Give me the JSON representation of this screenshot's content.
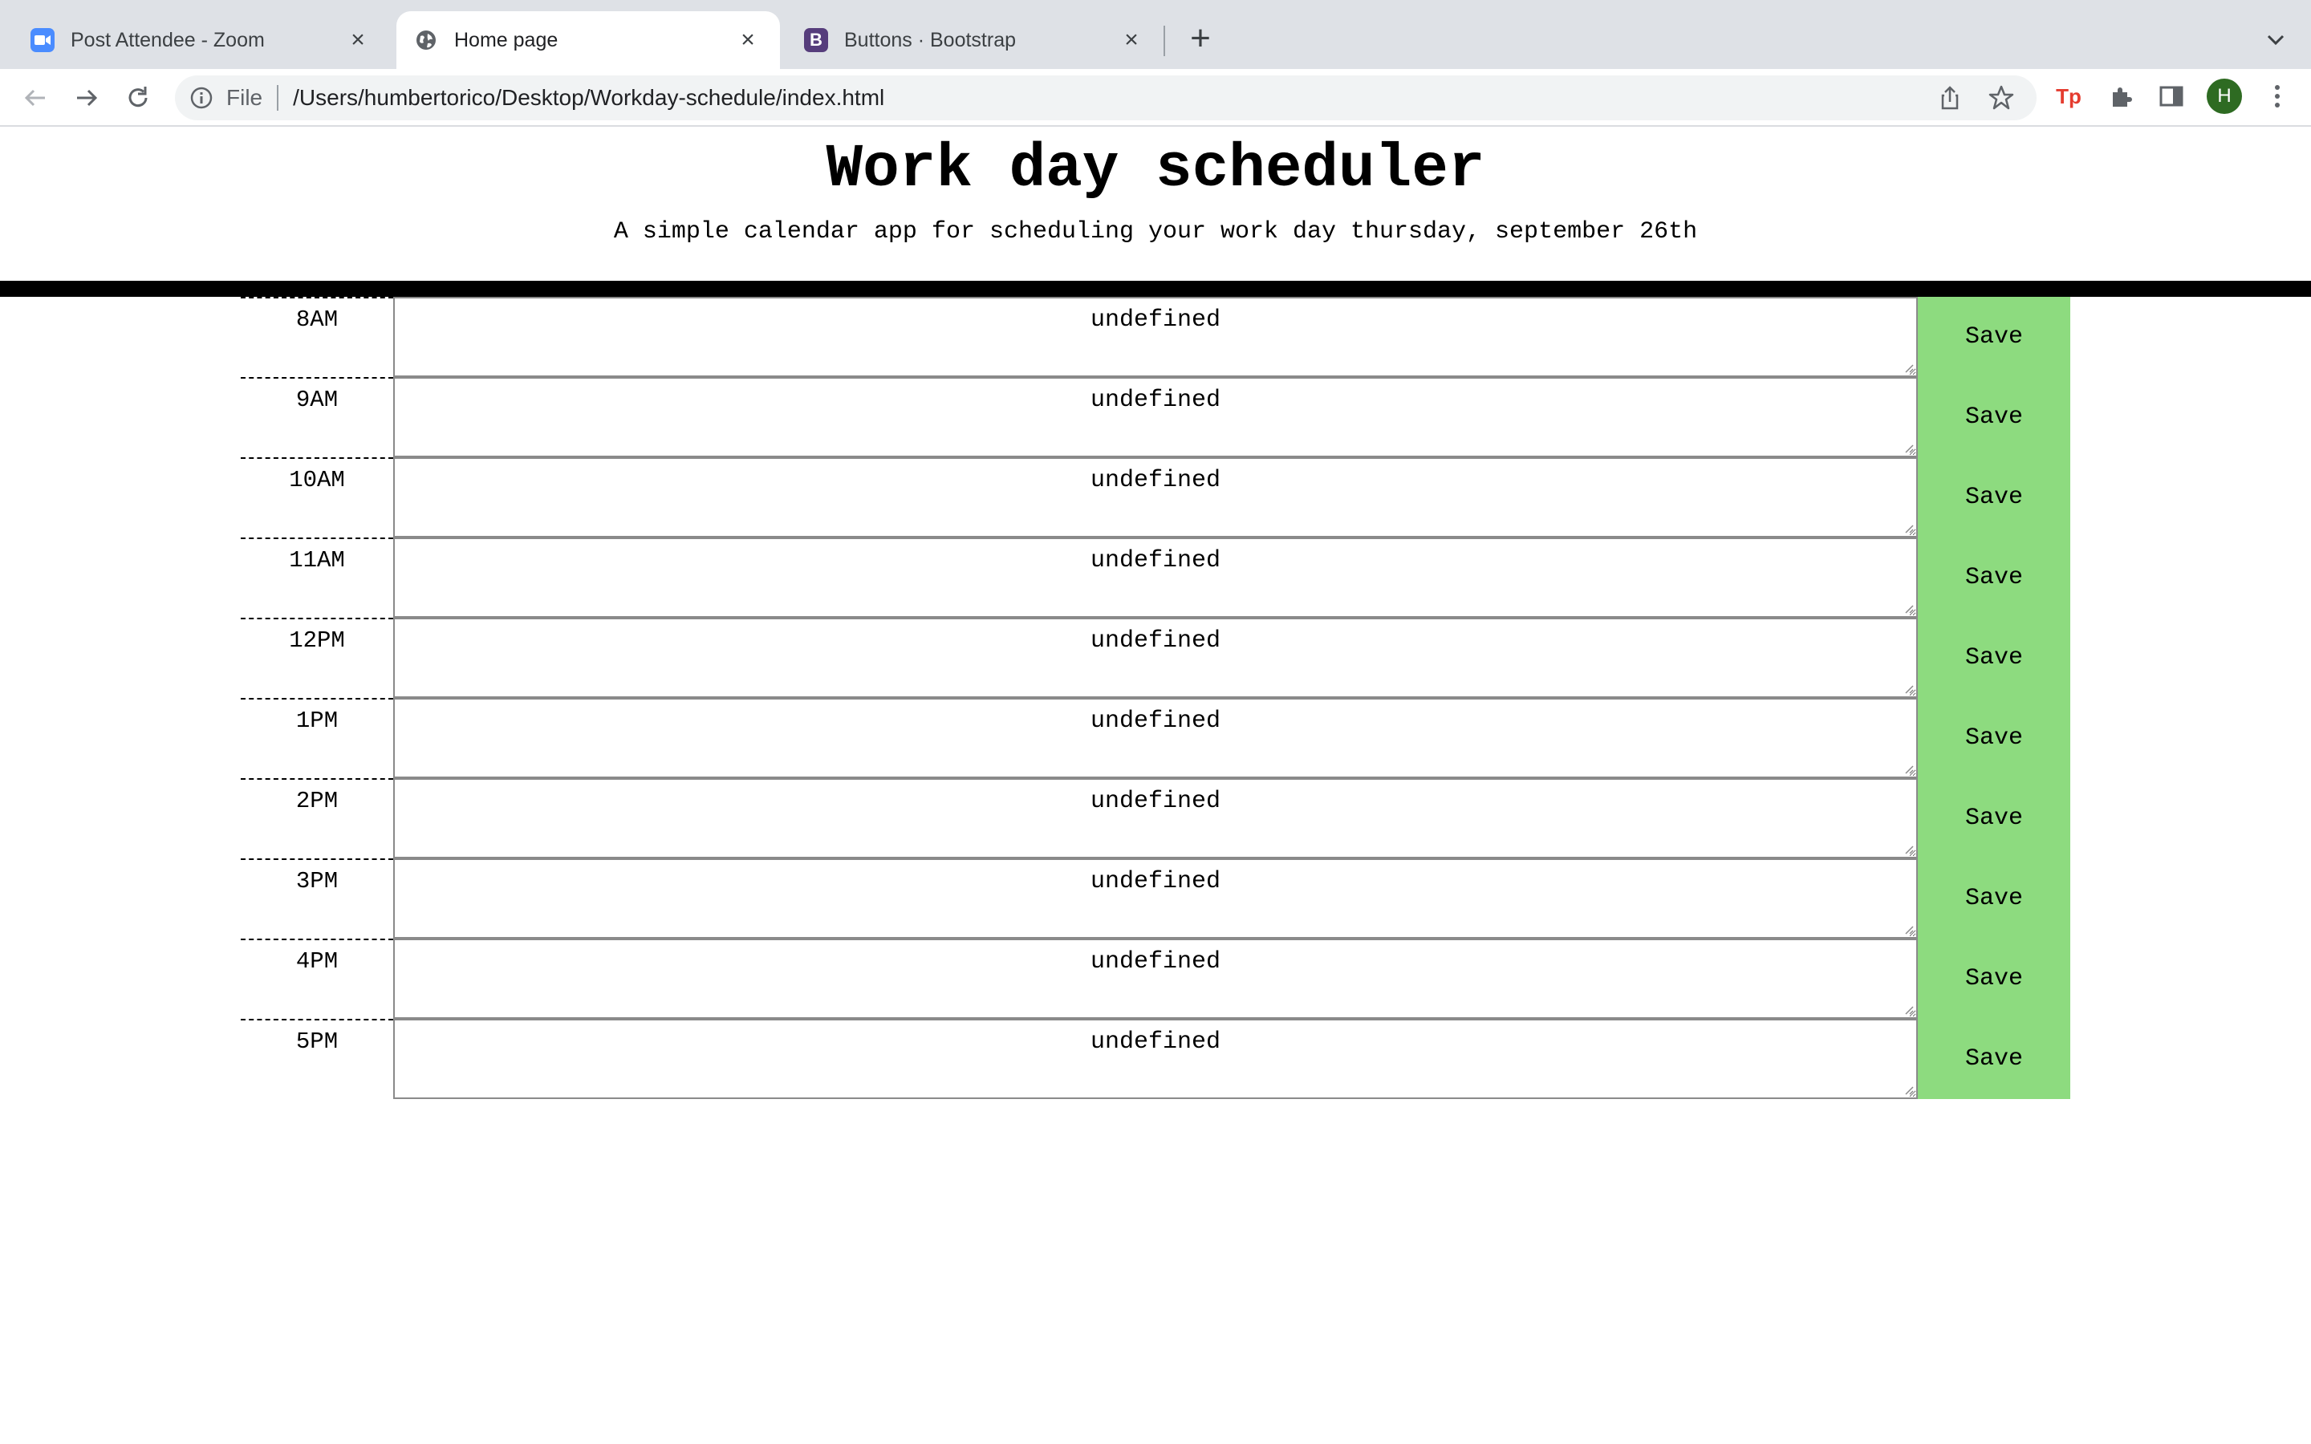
{
  "browser": {
    "tabs": [
      {
        "title": "Post Attendee - Zoom",
        "icon": "zoom-icon",
        "active": false
      },
      {
        "title": "Home page",
        "icon": "globe-icon",
        "active": true
      },
      {
        "title": "Buttons · Bootstrap",
        "icon": "bootstrap-icon",
        "active": false
      }
    ],
    "omnibox": {
      "scheme_label": "File",
      "url": "/Users/humbertorico/Desktop/Workday-schedule/index.html"
    },
    "avatar_initial": "H",
    "extension_label": "Tp",
    "bootstrap_letter": "B"
  },
  "header": {
    "title": "Work day scheduler",
    "lead": "A simple calendar app for scheduling your work day thursday, september 26th"
  },
  "schedule": {
    "rows": [
      {
        "hour": "8AM",
        "text": "undefined",
        "save_label": "Save"
      },
      {
        "hour": "9AM",
        "text": "undefined",
        "save_label": "Save"
      },
      {
        "hour": "10AM",
        "text": "undefined",
        "save_label": "Save"
      },
      {
        "hour": "11AM",
        "text": "undefined",
        "save_label": "Save"
      },
      {
        "hour": "12PM",
        "text": "undefined",
        "save_label": "Save"
      },
      {
        "hour": "1PM",
        "text": "undefined",
        "save_label": "Save"
      },
      {
        "hour": "2PM",
        "text": "undefined",
        "save_label": "Save"
      },
      {
        "hour": "3PM",
        "text": "undefined",
        "save_label": "Save"
      },
      {
        "hour": "4PM",
        "text": "undefined",
        "save_label": "Save"
      },
      {
        "hour": "5PM",
        "text": "undefined",
        "save_label": "Save"
      }
    ]
  },
  "colors": {
    "save_button": "#8ddb7f",
    "tab_strip": "#dee1e6",
    "jumbotron_border": "#000000"
  }
}
